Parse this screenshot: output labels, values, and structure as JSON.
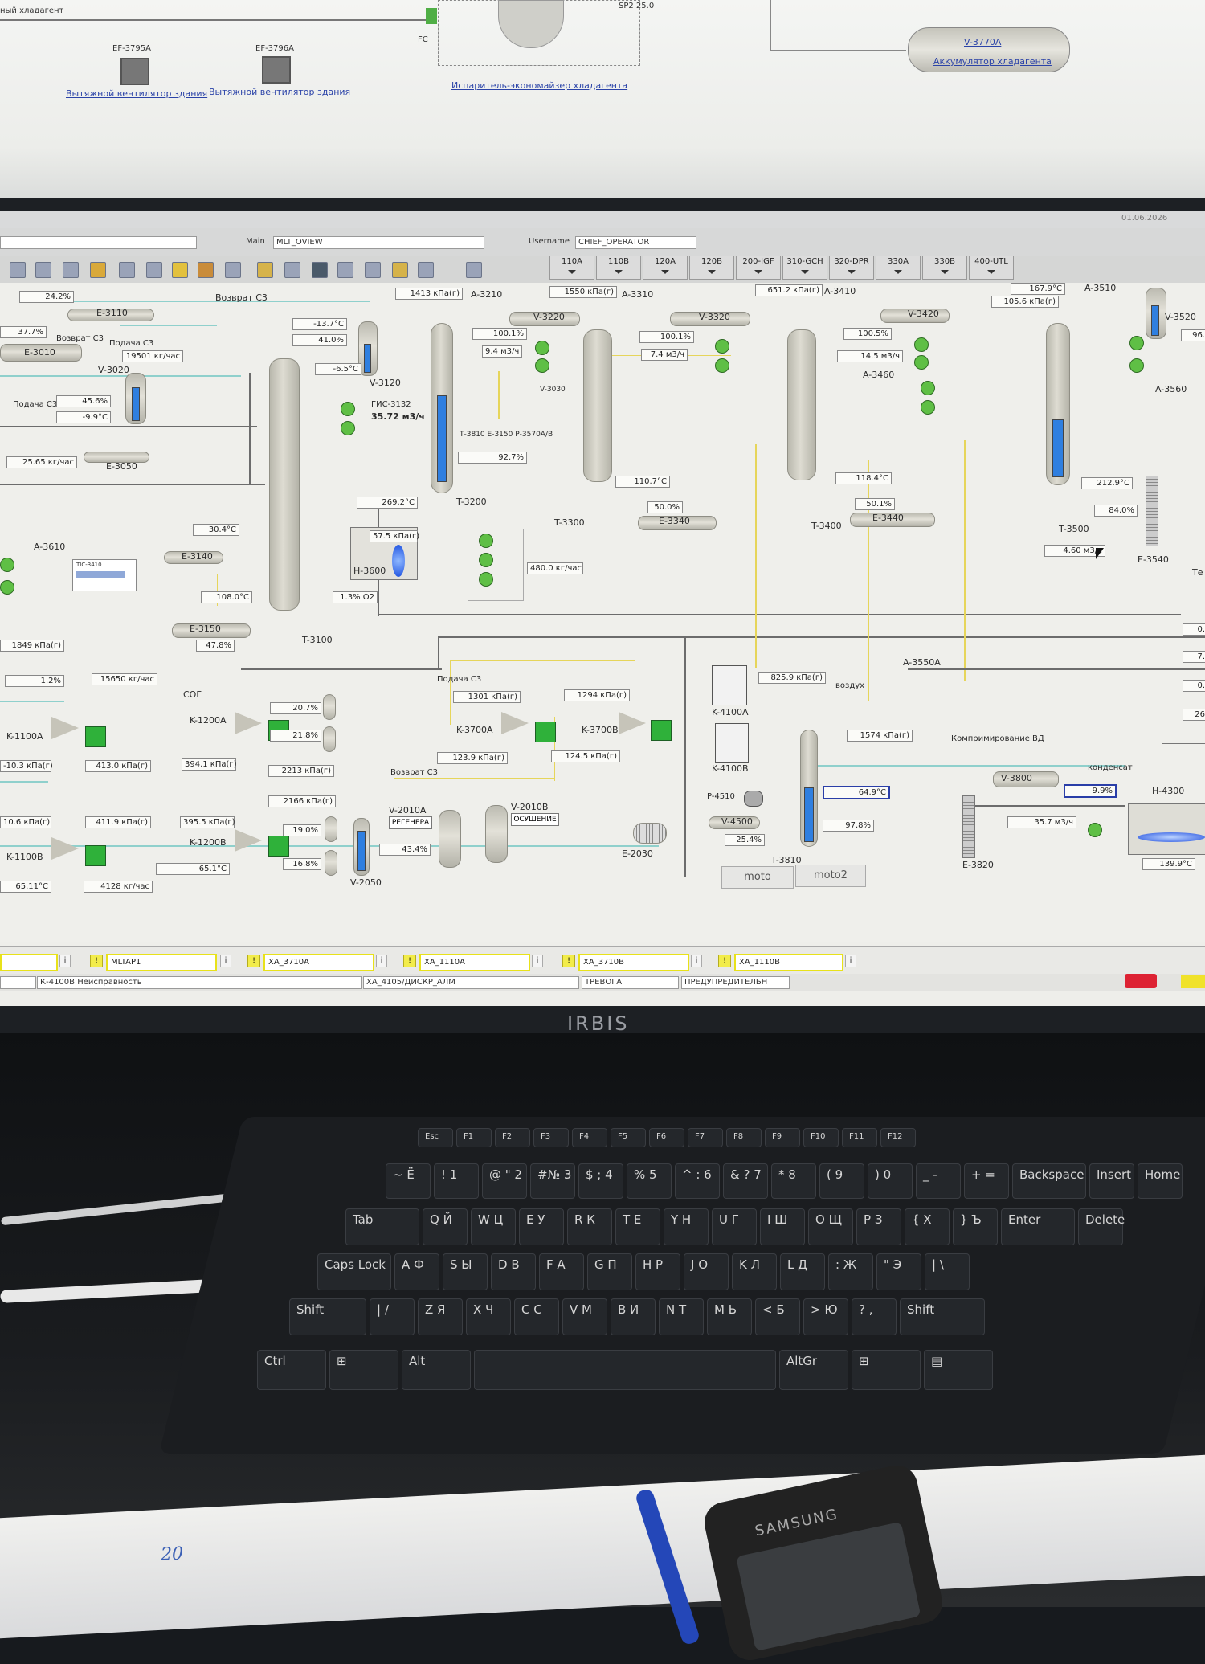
{
  "top_screen": {
    "header_left": "ный хладагент",
    "fan1_tag": "EF-3795A",
    "fan2_tag": "EF-3796A",
    "fan_label_1": "Вытяжной вентилятор здания",
    "fan_label_2": "Вытяжной вентилятор здания",
    "fc_label": "FC",
    "evap_label": "Испаритель-экономайзер хладагента",
    "sp_label": "SP2  25.0",
    "v3770_tag": "V-3770A",
    "v3770_label": "Аккумулятор хладагента"
  },
  "toolbar": {
    "main_label": "Main",
    "main_value": "MLT_OVIEW",
    "username_label": "Username",
    "username_value": "CHIEF_OPERATOR",
    "date": "01.06.2026",
    "tabs": [
      "110A",
      "110B",
      "120A",
      "120B",
      "200-IGF",
      "310-GCH",
      "320-DPR",
      "330A",
      "330B",
      "400-UTL"
    ]
  },
  "process": {
    "texts": {
      "vozvrat_c3": "Возврат С3",
      "podacha_c3": "Подача С3",
      "fis": "ГИС-3132",
      "fis_val": "35.72 м3/ч",
      "t3810_note": "Т-3810  Е-3150  Р-3570А/В",
      "v3030": "V-3030",
      "kompr": "Компримирование ВД",
      "kondensat": "конденсат",
      "vozdukh": "воздух",
      "sog": "СОГ",
      "regen": "РЕГЕНЕРА",
      "osush": "ОСУШЕНИЕ",
      "mini_tic": "ТIC-3410"
    },
    "tags": {
      "E3110": "E-3110",
      "E3010": "E-3010",
      "V3020": "V-3020",
      "E3050": "E-3050",
      "V3120": "V-3120",
      "A3610": "A-3610",
      "E3140": "E-3140",
      "E3150": "E-3150",
      "T3100": "T-3100",
      "H3600": "H-3600",
      "T3200": "T-3200",
      "A3210": "A-3210",
      "V3220": "V-3220",
      "A3310": "A-3310",
      "V3320": "V-3320",
      "T3300": "T-3300",
      "E3340": "E-3340",
      "A3410": "A-3410",
      "V3420": "V-3420",
      "A3460": "A-3460",
      "T3400": "T-3400",
      "E3440": "E-3440",
      "A3510": "A-3510",
      "V3520": "V-3520",
      "A3560": "A-3560",
      "T3500": "T-3500",
      "E3540": "E-3540",
      "K1100A": "K-1100A",
      "K1100B": "K-1100B",
      "K1200A": "K-1200A",
      "K1200B": "K-1200B",
      "K3700A": "K-3700A",
      "K3700B": "K-3700B",
      "V2010A": "V-2010A",
      "V2010B": "V-2010B",
      "V2050": "V-2050",
      "E2030": "E-2030",
      "K4100A": "K-4100A",
      "K4100B": "K-4100B",
      "P4510": "P-4510",
      "V4500": "V-4500",
      "T3810": "T-3810",
      "A3550A": "A-3550A",
      "V3800": "V-3800",
      "E3820": "E-3820",
      "H4300": "H-4300",
      "te": "Те"
    },
    "values": {
      "v1": "24.2%",
      "v2": "37.7%",
      "v3": "19501 кг/час",
      "v4": "45.6%",
      "v5": "-9.9°C",
      "v6": "25.65 кг/час",
      "v7": "-13.7°C",
      "v8": "41.0%",
      "v9": "-6.5°C",
      "v10": "30.4°C",
      "v11": "108.0°C",
      "v12": "47.8%",
      "v13": "269.2°C",
      "v14": "57.5 кПа(г)",
      "v15": "1.3% O2",
      "v16": "1413 кПа(г)",
      "v17": "100.1%",
      "v18": "9.4 м3/ч",
      "v19": "92.7%",
      "v20": "1550 кПа(г)",
      "v21": "100.1%",
      "v22": "7.4 м3/ч",
      "v23": "110.7°C",
      "v24": "50.0%",
      "v25": "480.0 кг/час",
      "v26": "651.2 кПа(г)",
      "v27": "100.5%",
      "v28": "14.5 м3/ч",
      "v29": "118.4°C",
      "v30": "50.1%",
      "v31": "167.9°C",
      "v32": "105.6 кПа(г)",
      "v33": "212.9°C",
      "v34": "84.0%",
      "v35": "4.60 м3/ч",
      "v36": "96.",
      "v37": "1849 кПа(г)",
      "v38": "1.2%",
      "v39": "15650 кг/час",
      "v40": "-10.3 кПа(г)",
      "v41": "413.0 кПа(г)",
      "v42": "10.6 кПа(г)",
      "v43": "411.9 кПа(г)",
      "v44": "65.11°C",
      "v45": "4128 кг/час",
      "v46": "20.7%",
      "v47": "21.8%",
      "v48": "394.1 кПа(г)",
      "v49": "2213 кПа(г)",
      "v50": "2166 кПа(г)",
      "v51": "395.5 кПа(г)",
      "v52": "19.0%",
      "v53": "16.8%",
      "v54": "65.1°C",
      "v55": "43.4%",
      "v56": "1301 кПа(г)",
      "v57": "1294 кПа(г)",
      "v58": "123.9 кПа(г)",
      "v59": "124.5 кПа(г)",
      "v60": "825.9 кПа(г)",
      "v61": "1574 кПа(г)",
      "v62": "64.9°C",
      "v63": "97.8%",
      "v64": "25.4%",
      "v65": "35.7 м3/ч",
      "v66": "9.9%",
      "v67": "139.9°C",
      "side1": "0.",
      "side2": "7.",
      "side3": "0.",
      "side4": "26"
    },
    "buttons": {
      "moto": "moto",
      "moto2": "moto2"
    }
  },
  "alarms": {
    "items": [
      "MLTAP1",
      "XA_3710A",
      "XA_1110A",
      "XA_3710B",
      "XA_1110B"
    ],
    "status_msg": "К-4100В Неисправность",
    "status_tag": "XA_4105/ДИСКР_АЛМ",
    "status_type": "ТРЕВОГА",
    "status_class": "ПРЕДУПРЕДИТЕЛЬН",
    "badge": "!",
    "info": "i"
  },
  "hardware": {
    "monitor_brand": "IRBIS",
    "phone_brand": "SAMSUNG",
    "note": "20"
  },
  "keyboard": {
    "rows": [
      [
        "Esc",
        "F1",
        "F2",
        "F3",
        "F4",
        "F5",
        "F6",
        "F7",
        "F8",
        "F9",
        "F10",
        "F11",
        "F12"
      ],
      [
        "~ Ё",
        "! 1",
        "@ \" 2",
        "#№ 3",
        "$ ; 4",
        "% 5",
        "^ : 6",
        "& ? 7",
        "* 8",
        "( 9",
        ") 0",
        "_ -",
        "+ =",
        "Backspace",
        "Insert",
        "Home"
      ],
      [
        "Tab",
        "Q Й",
        "W Ц",
        "E У",
        "R К",
        "T Е",
        "Y Н",
        "U Г",
        "I Ш",
        "O Щ",
        "P З",
        "{ Х",
        "} Ъ",
        "Enter",
        "Delete"
      ],
      [
        "Caps Lock",
        "A Ф",
        "S Ы",
        "D В",
        "F А",
        "G П",
        "H Р",
        "J О",
        "K Л",
        "L Д",
        ": Ж",
        "\" Э",
        "| \\"
      ],
      [
        "Shift",
        "| /",
        "Z Я",
        "X Ч",
        "C С",
        "V М",
        "B И",
        "N Т",
        "M Ь",
        "< Б",
        "> Ю",
        "? ,",
        "Shift"
      ],
      [
        "Ctrl",
        "⊞",
        "Alt",
        "",
        "AltGr",
        "⊞",
        "▤"
      ]
    ]
  }
}
